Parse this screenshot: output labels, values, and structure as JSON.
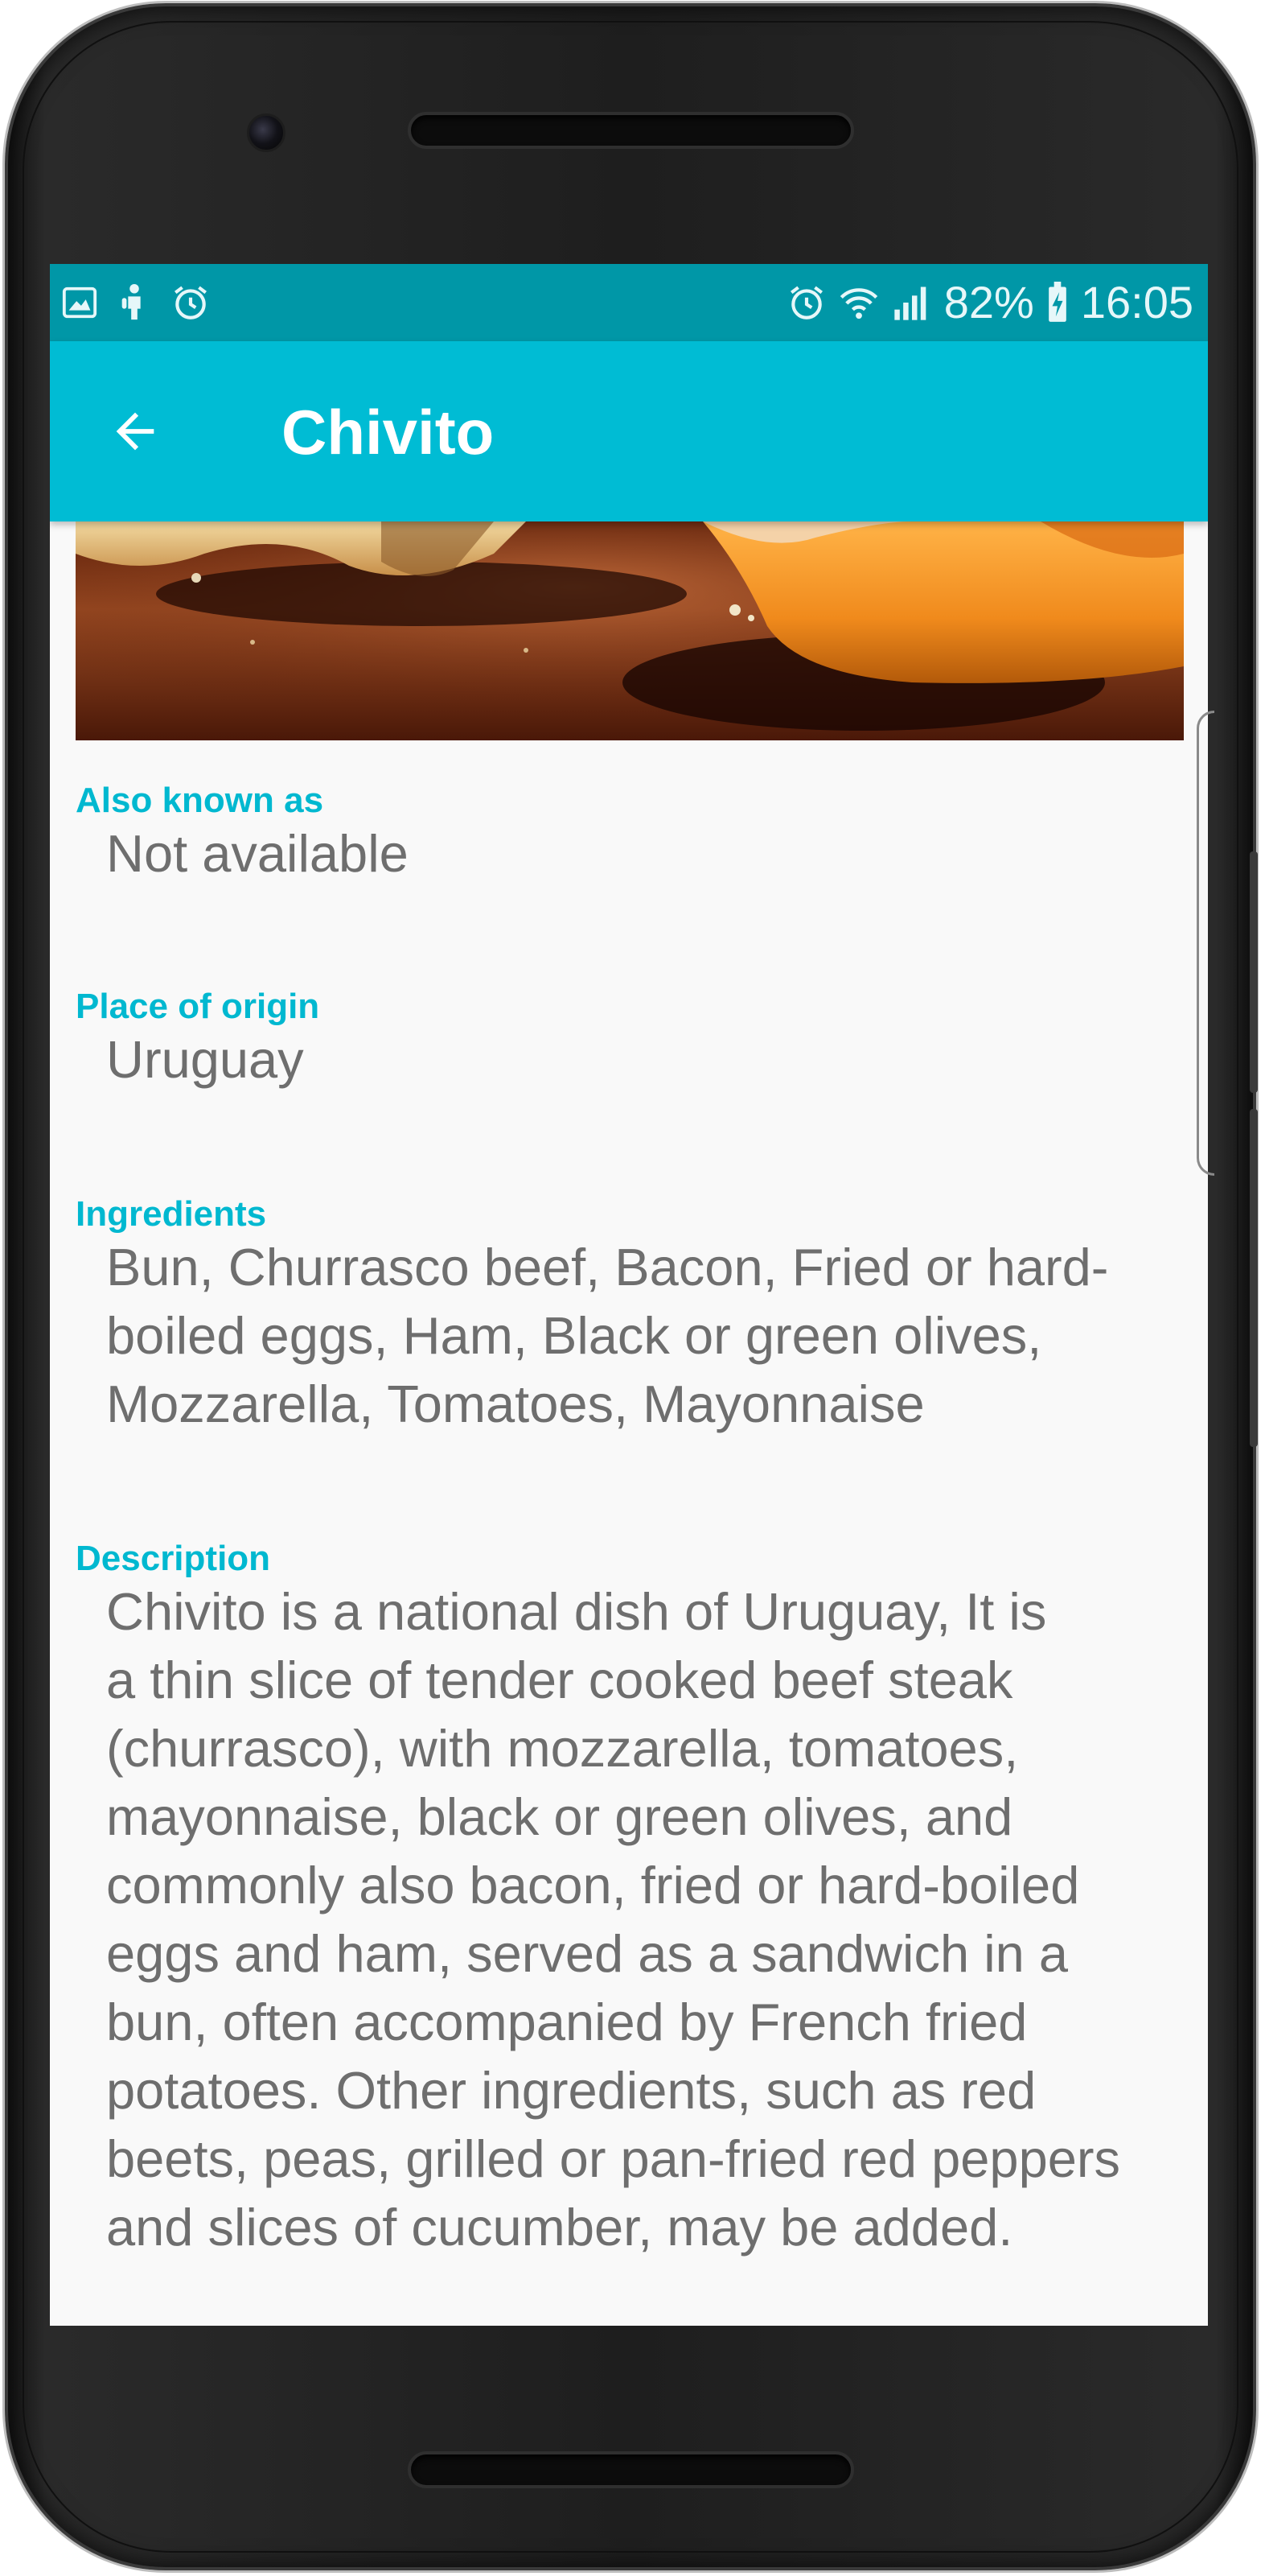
{
  "status_bar": {
    "icons_left": [
      "image-icon",
      "android-icon",
      "alarm-icon"
    ],
    "icons_right": [
      "alarm-icon",
      "wifi-icon",
      "signal-icon"
    ],
    "battery_percent": "82%",
    "battery_icon": "battery-charging-icon",
    "time": "16:05",
    "color": "#0097a7"
  },
  "app_bar": {
    "back_icon": "arrow-back-icon",
    "title": "Chivito",
    "color": "#00bcd4"
  },
  "details": {
    "also_known_as": {
      "label": "Also known as",
      "value": "Not available"
    },
    "place_of_origin": {
      "label": "Place of origin",
      "value": "Uruguay"
    },
    "ingredients": {
      "label": "Ingredients",
      "value": "Bun, Churrasco beef, Bacon, Fried or hard-\nboiled eggs, Ham, Black or green olives,\nMozzarella, Tomatoes, Mayonnaise"
    },
    "description": {
      "label": "Description",
      "value": "Chivito is a national dish of Uruguay, It is\na thin slice of tender cooked beef steak\n(churrasco), with mozzarella, tomatoes,\nmayonnaise, black or green olives, and\ncommonly also bacon, fried or hard-boiled\neggs and ham, served as a sandwich in a\nbun, often accompanied by French fried\npotatoes. Other ingredients, such as red\nbeets, peas, grilled or pan-fried red peppers\nand slices of cucumber, may be added."
    }
  },
  "colors": {
    "accent": "#00b8d0",
    "text_secondary": "#6e6e6e",
    "background": "#f9f9f9"
  }
}
